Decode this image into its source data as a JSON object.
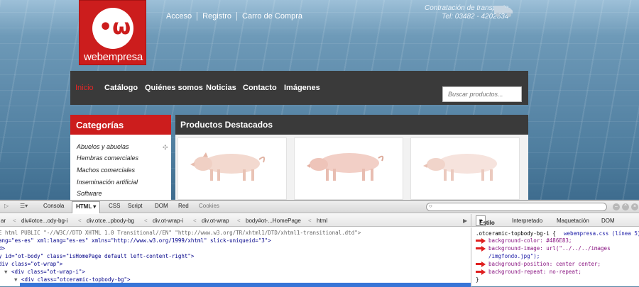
{
  "site": {
    "logo_text": "webempresa",
    "top_links": [
      "Acceso",
      "Registro",
      "Carro de Compra"
    ],
    "transport": {
      "line1": "Contratación de transporte",
      "line2": "Tel: 03482 - 4202534"
    },
    "nav": [
      "Inicio",
      "Catálogo",
      "Quiénes somos",
      "Noticias",
      "Contacto",
      "Imágenes"
    ],
    "search_placeholder": "Buscar productos...",
    "categories_title": "Categorías",
    "categories": [
      "Abuelos y abuelas",
      "Hembras comerciales",
      "Machos comerciales",
      "Inseminación artificial",
      "Software"
    ],
    "products_title": "Productos Destacados"
  },
  "devtools": {
    "tabs": [
      "Consola",
      "HTML",
      "CSS",
      "Script",
      "DOM",
      "Red",
      "Cookies"
    ],
    "active_tab": "HTML",
    "breadcrumbs": [
      "ar",
      "div#otce...ody-bg-i",
      "div.otce...pbody-bg",
      "div.ot-wrap-i",
      "div.ot-wrap",
      "body#ot-...HomePage",
      "html"
    ],
    "right_tabs": [
      "Estilo",
      "Interpretado",
      "Maquetación",
      "DOM"
    ],
    "source": [
      "E html PUBLIC \"-//W3C//DTD XHTML 1.0 Transitional//EN\" \"http://www.w3.org/TR/xhtml1/DTD/xhtml1-transitional.dtd\">",
      "ang=\"es-es\" xml:lang=\"es-es\" xmlns=\"http://www.w3.org/1999/xhtml\" slick-uniqueid=\"3\">",
      "d>",
      "y id=\"ot-body\" class=\"isHomePage default left-content-right\">",
      "div class=\"ot-wrap\">",
      "<div class=\"ot-wrap-i\">",
      "<div class=\"otceramic-topbody-bg\">"
    ],
    "css": {
      "selector": ".otceramic-topbody-bg-i {",
      "file": "webempresa.css (línea 5)",
      "rules": [
        "background-color: #486E83;",
        "background-image: url(\"../../../images",
        "/imgfondo.jpg\");",
        "background-position: center center;",
        "background-repeat: no-repeat;",
        "}"
      ]
    }
  },
  "colors": {
    "brand_red": "#CC1D1D",
    "nav_dark": "#3A3A3A",
    "selection_blue": "#3875D7",
    "bg_sample": "#486E83"
  }
}
